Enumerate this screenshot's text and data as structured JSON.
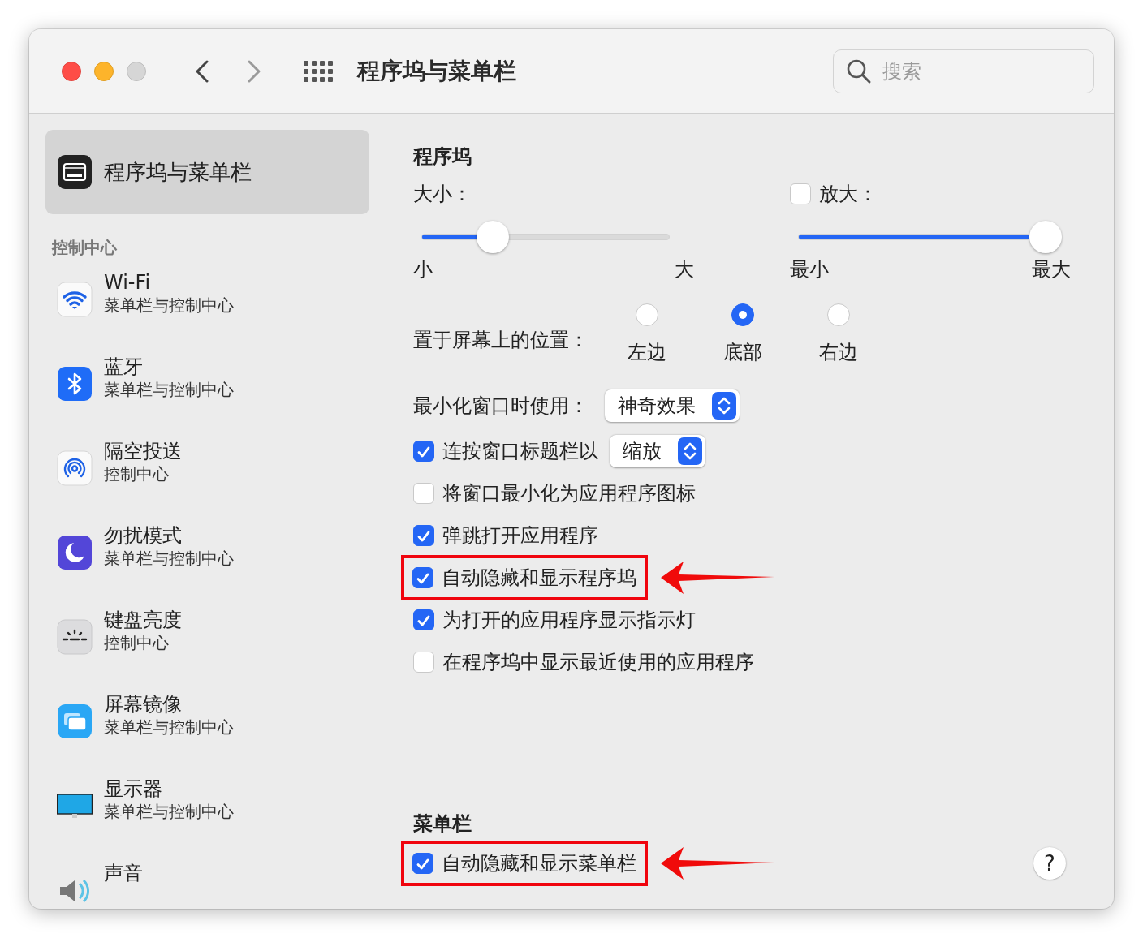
{
  "window": {
    "title": "程序坞与菜单栏",
    "search": {
      "placeholder": "搜索"
    }
  },
  "sidebar": {
    "pinned": [
      {
        "label": "程序坞与菜单栏",
        "selected": true
      }
    ],
    "section": "控制中心",
    "items": [
      {
        "title": "Wi-Fi",
        "subtitle": "菜单栏与控制中心",
        "selected": false
      },
      {
        "title": "蓝牙",
        "subtitle": "菜单栏与控制中心",
        "selected": false
      },
      {
        "title": "隔空投送",
        "subtitle": "控制中心",
        "selected": false
      },
      {
        "title": "勿扰模式",
        "subtitle": "菜单栏与控制中心",
        "selected": false
      },
      {
        "title": "键盘亮度",
        "subtitle": "控制中心",
        "selected": false
      },
      {
        "title": "屏幕镜像",
        "subtitle": "菜单栏与控制中心",
        "selected": false
      },
      {
        "title": "显示器",
        "subtitle": "菜单栏与控制中心",
        "selected": false
      },
      {
        "title": "声音",
        "selected": false
      }
    ]
  },
  "dock": {
    "heading": "程序坞",
    "size": {
      "label": "大小：",
      "level": 0.27,
      "min_label": "小",
      "max_label": "大"
    },
    "magnification": {
      "label": "放大：",
      "checked": false,
      "level": 1,
      "min_label": "最小",
      "max_label": "最大"
    },
    "position": {
      "label": "置于屏幕上的位置：",
      "options": [
        {
          "label": "左边",
          "selected": false
        },
        {
          "label": "底部",
          "selected": true
        },
        {
          "label": "右边",
          "selected": false
        }
      ]
    },
    "minimize_effect": {
      "label": "最小化窗口时使用：",
      "value": "神奇效果"
    },
    "options": [
      {
        "kind": "popup",
        "label": "连按窗口标题栏以",
        "checked": true,
        "value": "缩放",
        "highlighted": false
      },
      {
        "kind": "check",
        "label": "将窗口最小化为应用程序图标",
        "checked": false,
        "highlighted": false
      },
      {
        "kind": "check",
        "label": "弹跳打开应用程序",
        "checked": true,
        "highlighted": false
      },
      {
        "kind": "check",
        "label": "自动隐藏和显示程序坞",
        "checked": true,
        "highlighted": true
      },
      {
        "kind": "check",
        "label": "为打开的应用程序显示指示灯",
        "checked": true,
        "highlighted": false
      },
      {
        "kind": "check",
        "label": "在程序坞中显示最近使用的应用程序",
        "checked": false,
        "highlighted": false
      }
    ]
  },
  "menu_bar": {
    "heading": "菜单栏",
    "options": [
      {
        "kind": "check",
        "label": "自动隐藏和显示菜单栏",
        "checked": true,
        "highlighted": true
      }
    ]
  },
  "help_button": "?"
}
